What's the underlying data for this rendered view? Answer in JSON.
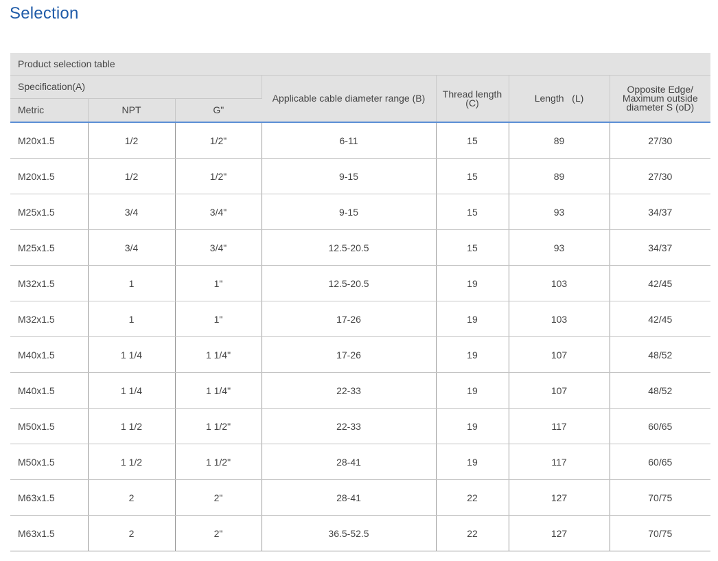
{
  "page": {
    "title": "Selection"
  },
  "table": {
    "caption": "Product selection table",
    "headers": {
      "specification": "Specification(A)",
      "metric": "Metric",
      "npt": "NPT",
      "g": "G\"",
      "cable_range": "Applicable cable diameter range (B)",
      "thread_length": "Thread length (C)",
      "length": "Length   (L)",
      "opposite_edge": "Opposite Edge/ Maximum outside diameter S (oD)"
    },
    "rows": [
      [
        "M20x1.5",
        "1/2",
        "1/2\"",
        "6-11",
        "15",
        "89",
        "27/30"
      ],
      [
        "M20x1.5",
        "1/2",
        "1/2\"",
        "9-15",
        "15",
        "89",
        "27/30"
      ],
      [
        "M25x1.5",
        "3/4",
        "3/4\"",
        "9-15",
        "15",
        "93",
        "34/37"
      ],
      [
        "M25x1.5",
        "3/4",
        "3/4\"",
        "12.5-20.5",
        "15",
        "93",
        "34/37"
      ],
      [
        "M32x1.5",
        "1",
        "1\"",
        "12.5-20.5",
        "19",
        "103",
        "42/45"
      ],
      [
        "M32x1.5",
        "1",
        "1\"",
        "17-26",
        "19",
        "103",
        "42/45"
      ],
      [
        "M40x1.5",
        "1 1/4",
        "1 1/4\"",
        "17-26",
        "19",
        "107",
        "48/52"
      ],
      [
        "M40x1.5",
        "1 1/4",
        "1 1/4\"",
        "22-33",
        "19",
        "107",
        "48/52"
      ],
      [
        "M50x1.5",
        "1 1/2",
        "1 1/2\"",
        "22-33",
        "19",
        "117",
        "60/65"
      ],
      [
        "M50x1.5",
        "1 1/2",
        "1 1/2\"",
        "28-41",
        "19",
        "117",
        "60/65"
      ],
      [
        "M63x1.5",
        "2",
        "2\"",
        "28-41",
        "22",
        "127",
        "70/75"
      ],
      [
        "M63x1.5",
        "2",
        "2\"",
        "36.5-52.5",
        "22",
        "127",
        "70/75"
      ]
    ]
  },
  "colors": {
    "title": "#1f5ba8",
    "header_bg": "#e2e2e2",
    "header_rule": "#5b8fd6"
  }
}
